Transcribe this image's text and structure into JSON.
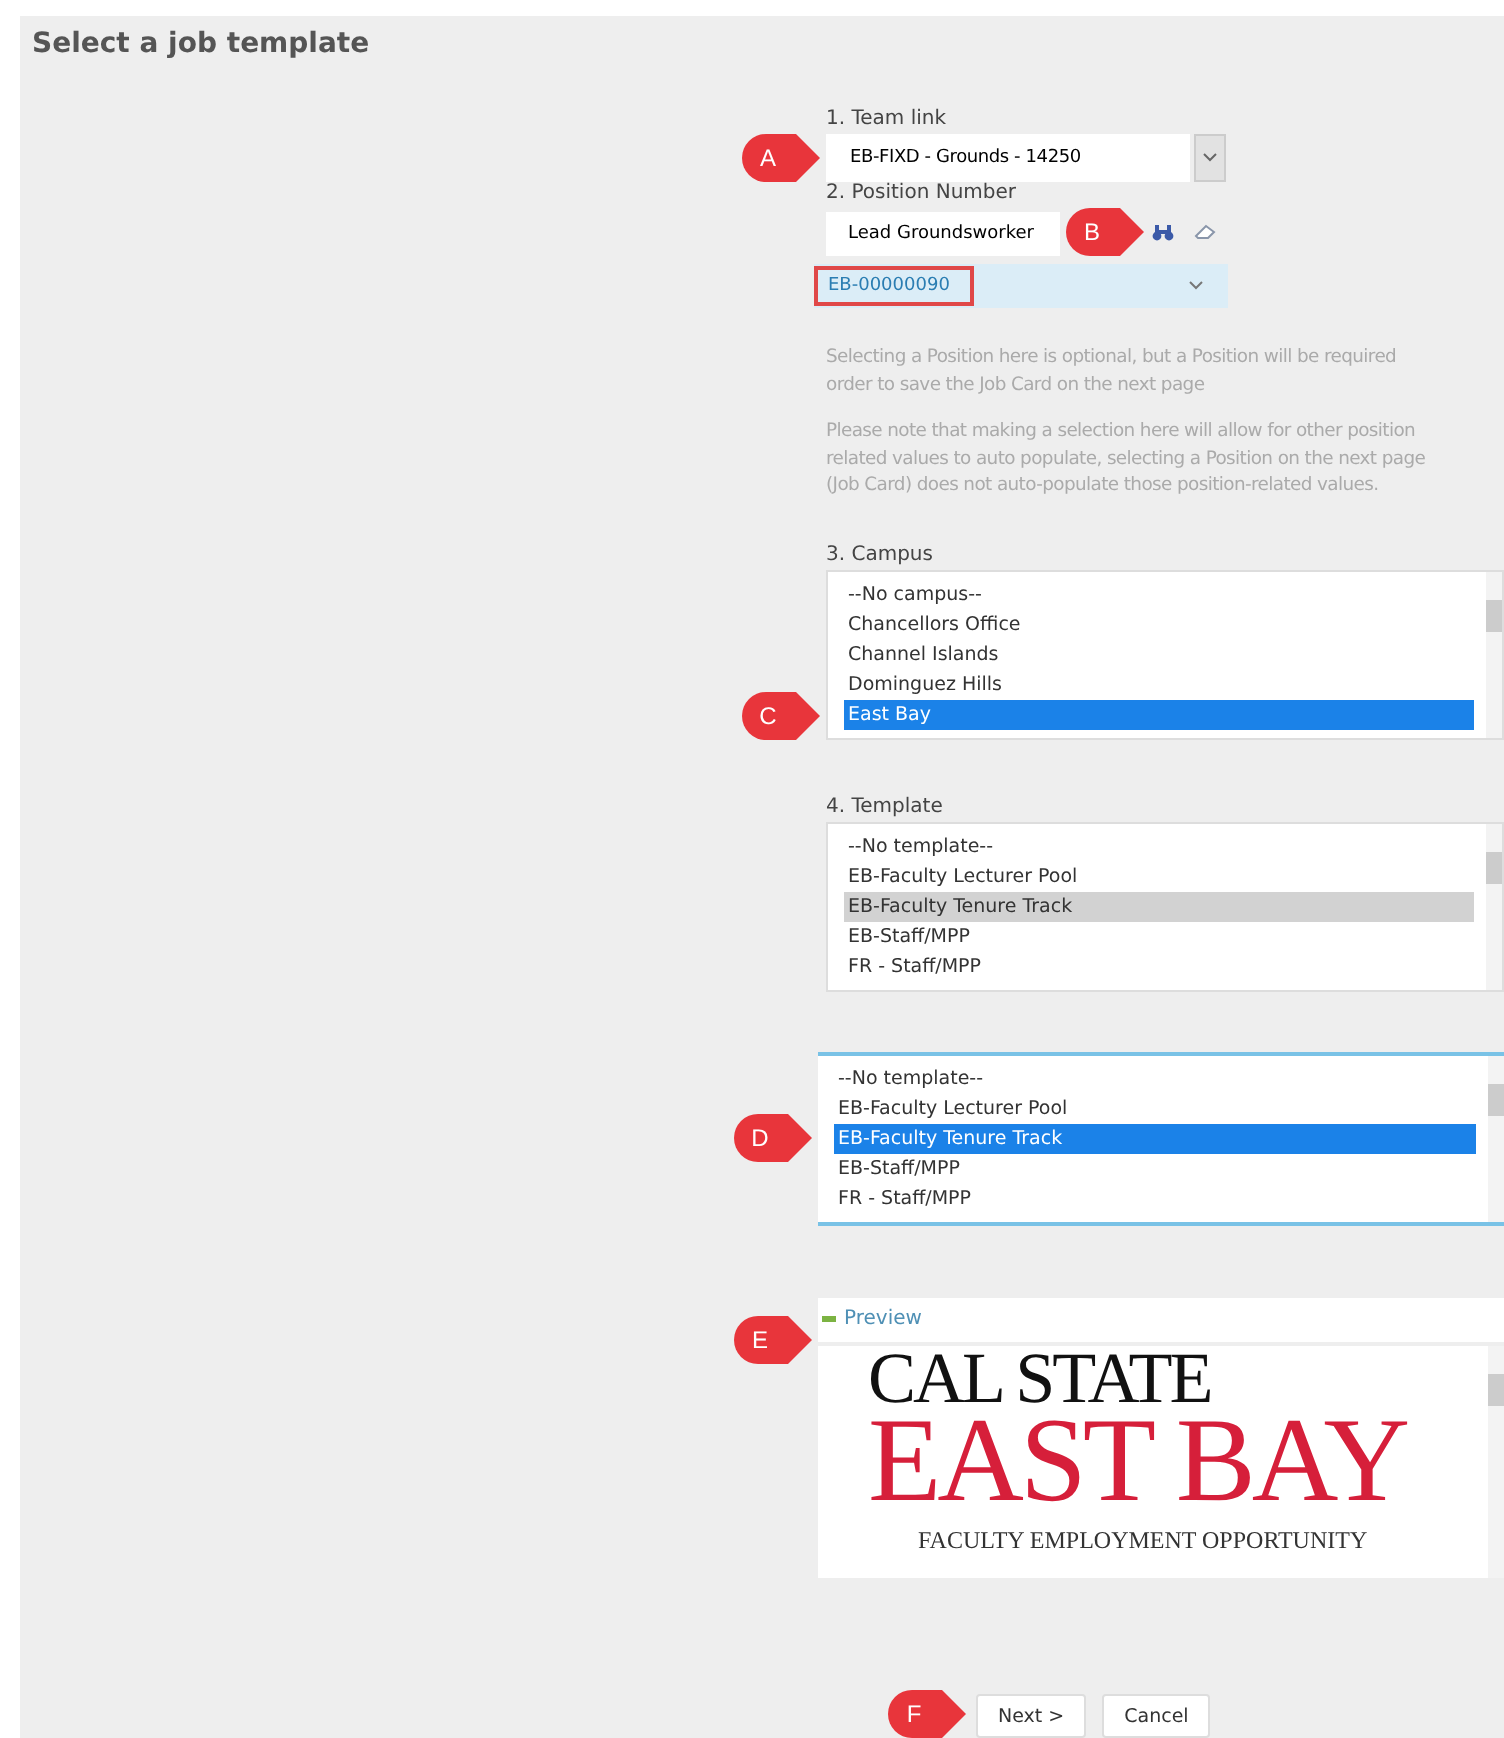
{
  "title": "Select a job template",
  "team_link": {
    "label": "1. Team link",
    "value": "EB-FIXD - Grounds - 14250",
    "marker": "A"
  },
  "position": {
    "label": "2. Position Number",
    "search_value": "Lead Groundsworker",
    "marker": "B",
    "number": "EB-00000090"
  },
  "help": [
    {
      "lines": [
        "Selecting a Position here is optional, but a Position will be required",
        "order to save the Job Card on the next page"
      ]
    },
    {
      "lines": [
        "Please note that making a selection here will allow for other position",
        "related values to auto populate, selecting a Position on the next page",
        "(Job Card) does not auto-populate those position-related values."
      ]
    }
  ],
  "campus": {
    "label": "3. Campus",
    "marker": "C",
    "focused": true,
    "outlined": false,
    "options": [
      {
        "text": "--No campus--",
        "selected": false
      },
      {
        "text": "Chancellors Office",
        "selected": false
      },
      {
        "text": "Channel Islands",
        "selected": false
      },
      {
        "text": "Dominguez Hills",
        "selected": false
      },
      {
        "text": "East Bay",
        "selected": true
      }
    ]
  },
  "template": {
    "label": "4. Template",
    "focused": false,
    "outlined": false,
    "options": [
      {
        "text": "--No template--",
        "selected": false
      },
      {
        "text": "EB-Faculty Lecturer Pool",
        "selected": false
      },
      {
        "text": "EB-Faculty Tenure Track",
        "selected": true
      },
      {
        "text": "EB-Staff/MPP",
        "selected": false
      },
      {
        "text": "FR - Staff/MPP",
        "selected": false
      }
    ]
  },
  "template_zoom": {
    "marker": "D",
    "focused": true,
    "outlined": true,
    "options": [
      {
        "text": "--No template--",
        "selected": false
      },
      {
        "text": "EB-Faculty Lecturer Pool",
        "selected": false
      },
      {
        "text": "EB-Faculty Tenure Track",
        "selected": true
      },
      {
        "text": "EB-Staff/MPP",
        "selected": false
      },
      {
        "text": "FR - Staff/MPP",
        "selected": false
      }
    ]
  },
  "preview": {
    "label": "Preview",
    "marker": "E",
    "expanded": true,
    "logo_top": "CAL STATE",
    "logo_main": "EAST BAY",
    "logo_caption": "FACULTY EMPLOYMENT OPPORTUNITY"
  },
  "buttons": [
    {
      "label": "Next >",
      "marker": "F"
    },
    {
      "label": "Cancel"
    }
  ]
}
